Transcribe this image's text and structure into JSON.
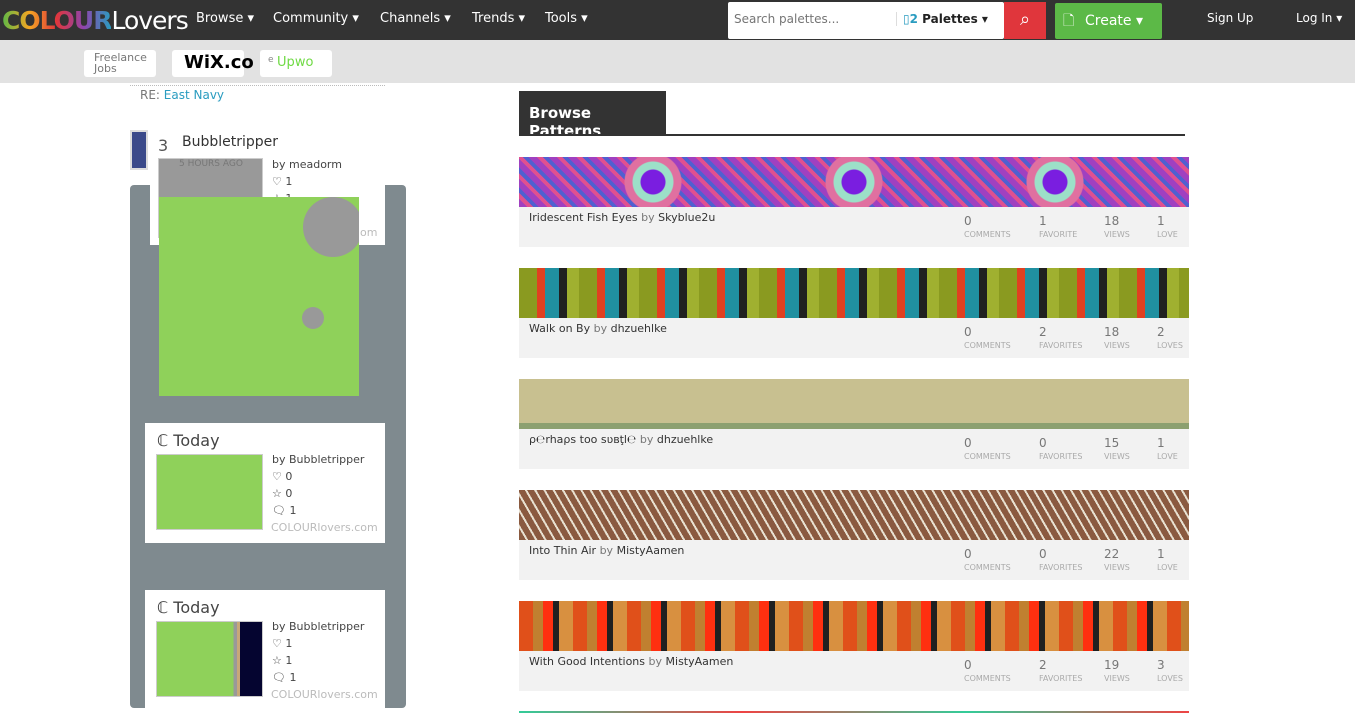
{
  "header": {
    "logo": {
      "colour": "COLOUR",
      "lovers": "Lovers"
    },
    "nav": [
      "Browse",
      "Community",
      "Channels",
      "Trends",
      "Tools"
    ],
    "search_placeholder": "Search palettes...",
    "search_type": "Palettes",
    "create": "Create",
    "sign_up": "Sign Up",
    "log_in": "Log In"
  },
  "ads": {
    "freelance": "Freelance Jobs",
    "wix": "WiX.co",
    "upwork_prefix": "e",
    "upwork": "Upwo"
  },
  "sidebar": {
    "re_label": "RE:",
    "re_link": "East Navy",
    "top_card": {
      "rank": "3",
      "title": "Bubbletripper",
      "time": "5 HOURS AGO",
      "by": "by meadorm",
      "loves": "1",
      "favs": "1",
      "footer": "om"
    },
    "cards": [
      {
        "title": "ℂ Today",
        "by": "by Bubbletripper",
        "loves": "0",
        "favs": "0",
        "comments": "1",
        "footer": "COLOURlovers.com"
      },
      {
        "title": "ℂ Today",
        "by": "by Bubbletripper",
        "loves": "1",
        "favs": "1",
        "comments": "1",
        "footer": "COLOURlovers.com"
      }
    ]
  },
  "main": {
    "tab": "Browse Patterns",
    "patterns": [
      {
        "title": "Iridescent Fish Eyes",
        "by": "by",
        "author": "Skyblue2u",
        "comments": "0",
        "comments_label": "COMMENTS",
        "favs": "1",
        "favs_label": "FAVORITE",
        "views": "18",
        "views_label": "VIEWS",
        "loves": "1",
        "loves_label": "LOVE"
      },
      {
        "title": "Walk on By",
        "by": "by",
        "author": "dhzuehlke",
        "comments": "0",
        "comments_label": "COMMENTS",
        "favs": "2",
        "favs_label": "FAVORITES",
        "views": "18",
        "views_label": "VIEWS",
        "loves": "2",
        "loves_label": "LOVES"
      },
      {
        "title": "ρ℮rhaρs too sʋʙţl℮",
        "by": "by",
        "author": "dhzuehlke",
        "comments": "0",
        "comments_label": "COMMENTS",
        "favs": "0",
        "favs_label": "FAVORITES",
        "views": "15",
        "views_label": "VIEWS",
        "loves": "1",
        "loves_label": "LOVE"
      },
      {
        "title": "Into Thin Air",
        "by": "by",
        "author": "MistyAamen",
        "comments": "0",
        "comments_label": "COMMENTS",
        "favs": "0",
        "favs_label": "FAVORITES",
        "views": "22",
        "views_label": "VIEWS",
        "loves": "1",
        "loves_label": "LOVE"
      },
      {
        "title": "With Good Intentions",
        "by": "by",
        "author": "MistyAamen",
        "comments": "0",
        "comments_label": "COMMENTS",
        "favs": "2",
        "favs_label": "FAVORITES",
        "views": "19",
        "views_label": "VIEWS",
        "loves": "3",
        "loves_label": "LOVES"
      }
    ]
  },
  "colors": {
    "header": "#333333",
    "search_button": "#e0363c",
    "create": "#5cb947",
    "link": "#2a9cc0",
    "panel": "#7f8a8f"
  }
}
